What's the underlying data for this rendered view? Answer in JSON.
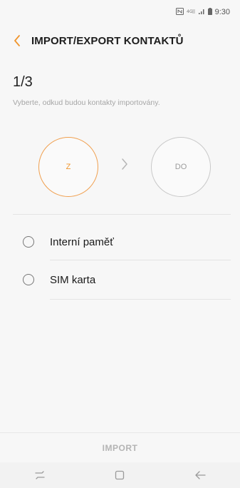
{
  "status_bar": {
    "time": "9:30",
    "icons": [
      "nfc-icon",
      "lte-icon",
      "signal-icon",
      "battery-icon"
    ]
  },
  "header": {
    "back_icon": "chevron-left-icon",
    "title": "IMPORT/EXPORT KONTAKTŮ"
  },
  "wizard": {
    "step": "1/3",
    "instruction": "Vyberte, odkud budou kontakty importovány.",
    "from_label": "Z",
    "to_label": "DO",
    "arrow_icon": "chevron-right-icon"
  },
  "options": [
    {
      "label": "Interní paměť",
      "selected": false
    },
    {
      "label": "SIM karta",
      "selected": false
    }
  ],
  "footer": {
    "import_label": "IMPORT"
  },
  "nav": {
    "recent_icon": "recent-apps-icon",
    "home_icon": "home-icon",
    "back_icon": "back-arrow-icon"
  },
  "colors": {
    "accent": "#f0962e",
    "disabled_text": "#b4b4b4",
    "background": "#f7f7f7"
  }
}
